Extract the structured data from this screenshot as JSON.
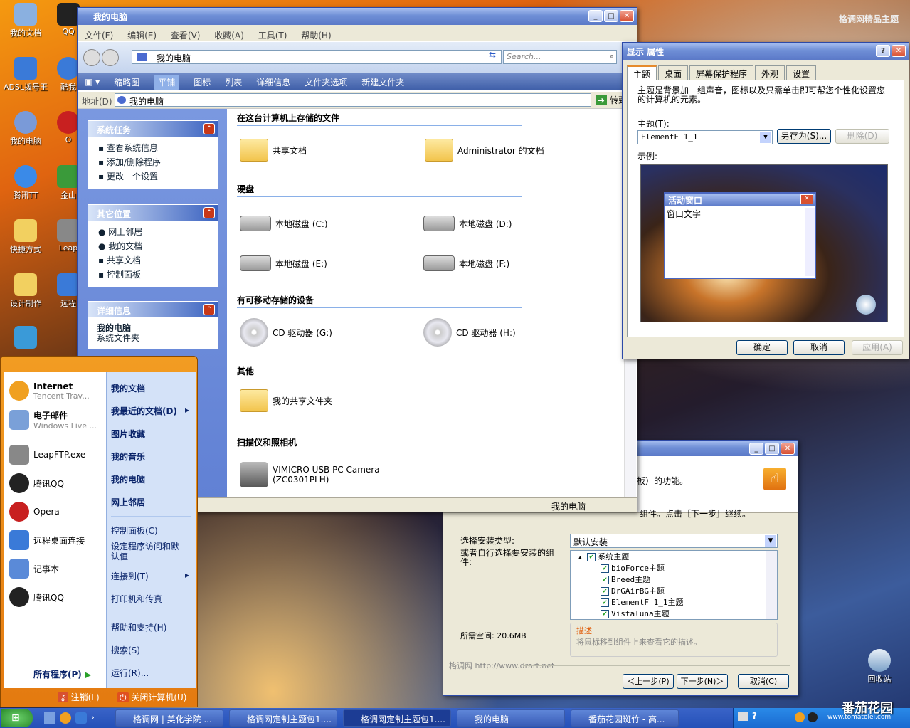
{
  "desktop": {
    "watermark": "格调网精品主题",
    "icons": [
      {
        "label": "我的文档",
        "color": "#8ab0e0"
      },
      {
        "label": "ADSL拨号王",
        "color": "#3a7ad8"
      },
      {
        "label": "我的电脑",
        "color": "#7a9ad8"
      },
      {
        "label": "腾讯TT",
        "color": "#3a8ae8"
      },
      {
        "label": "快捷方式",
        "color": "#f2d060"
      },
      {
        "label": "设计制作",
        "color": "#f2d060"
      },
      {
        "label": "QQ",
        "color": "#222"
      },
      {
        "label": "酷我",
        "color": "#3a7ad8"
      },
      {
        "label": "O",
        "color": "#c82020"
      },
      {
        "label": "金山",
        "color": "#3a9a3a"
      },
      {
        "label": "Leap",
        "color": "#888"
      },
      {
        "label": "远程",
        "color": "#3a7ad8"
      }
    ],
    "recycle_bin": "回收站",
    "brand": "番茄花园",
    "brand_url": "www.tomatolei.com"
  },
  "explorer": {
    "title": "我的电脑",
    "menu": [
      "文件(F)",
      "编辑(E)",
      "查看(V)",
      "收藏(A)",
      "工具(T)",
      "帮助(H)"
    ],
    "breadcrumb": "我的电脑",
    "search_placeholder": "Search...",
    "toolbar": [
      "缩略图",
      "平铺",
      "图标",
      "列表",
      "详细信息",
      "文件夹选项",
      "新建文件夹"
    ],
    "address_label": "地址(D)",
    "address_value": "我的电脑",
    "go_label": "转到",
    "panels": {
      "system_tasks": {
        "title": "系统任务",
        "items": [
          "查看系统信息",
          "添加/删除程序",
          "更改一个设置"
        ]
      },
      "other_places": {
        "title": "其它位置",
        "items": [
          "网上邻居",
          "我的文档",
          "共享文档",
          "控制面板"
        ]
      },
      "details": {
        "title": "详细信息",
        "name": "我的电脑",
        "type": "系统文件夹"
      }
    },
    "sections": {
      "stored": "在这台计算机上存储的文件",
      "hdd": "硬盘",
      "removable": "有可移动存储的设备",
      "other": "其他",
      "scanner": "扫描仪和照相机"
    },
    "items": {
      "shared_docs": "共享文档",
      "admin_docs": "Administrator 的文档",
      "disk_c": "本地磁盘 (C:)",
      "disk_d": "本地磁盘 (D:)",
      "disk_e": "本地磁盘 (E:)",
      "disk_f": "本地磁盘 (F:)",
      "cd_g": "CD 驱动器 (G:)",
      "cd_h": "CD 驱动器 (H:)",
      "my_shared": "我的共享文件夹",
      "camera_line1": "VIMICRO USB PC Camera",
      "camera_line2": "(ZC0301PLH)"
    },
    "status": "我的电脑"
  },
  "display_props": {
    "title": "显示 属性",
    "tabs": [
      "主题",
      "桌面",
      "屏幕保护程序",
      "外观",
      "设置"
    ],
    "description": "主题是背景加一组声音，图标以及只需单击即可帮您个性化设置您的计算机的元素。",
    "theme_label": "主题(T):",
    "theme_value": "ElementF 1_1",
    "save_as": "另存为(S)...",
    "delete": "删除(D)",
    "sample_label": "示例:",
    "sample_window_title": "活动窗口",
    "sample_window_text": "窗口文字",
    "ok": "确定",
    "cancel": "取消",
    "apply": "应用(A)"
  },
  "installer": {
    "header_text": "板）的功能。",
    "instruction": "组件。点击［下一步］继续。",
    "type_label": "选择安装类型:",
    "type_value": "默认安装",
    "custom_label": "或者自行选择要安装的组件:",
    "tree_root": "系统主题",
    "tree_items": [
      "bioForce主题",
      "Breed主题",
      "DrGAirBG主题",
      "ElementF 1_1主题",
      "Vistaluna主题"
    ],
    "desc_title": "描述",
    "desc_text": "将鼠标移到组件上来查看它的描述。",
    "space": "所需空间: 20.6MB",
    "footer": "格调网 http://www.drart.net",
    "back": "＜上一步(P)",
    "next": "下一步(N)＞",
    "cancel": "取消(C)"
  },
  "start_menu": {
    "pinned": [
      {
        "name": "Internet",
        "sub": "Tencent Trav...",
        "color": "#f0a020"
      },
      {
        "name": "电子邮件",
        "sub": "Windows Live ...",
        "color": "#7aa0d8"
      }
    ],
    "recent": [
      {
        "name": "LeapFTP.exe",
        "color": "#888"
      },
      {
        "name": "腾讯QQ",
        "color": "#222"
      },
      {
        "name": "Opera",
        "color": "#c82020"
      },
      {
        "name": "远程桌面连接",
        "color": "#3a7ad8"
      },
      {
        "name": "记事本",
        "color": "#5a8ad8"
      },
      {
        "name": "腾讯QQ",
        "color": "#222"
      }
    ],
    "all_programs": "所有程序(P)",
    "right": [
      "我的文档",
      "我最近的文档(D)",
      "图片收藏",
      "我的音乐",
      "我的电脑",
      "网上邻居",
      "控制面板(C)",
      "设定程序访问和默认值",
      "连接到(T)",
      "打印机和传真",
      "帮助和支持(H)",
      "搜索(S)",
      "运行(R)..."
    ],
    "logoff": "注销(L)",
    "shutdown": "关闭计算机(U)"
  },
  "taskbar": {
    "buttons": [
      "格调网 | 美化学院 ...",
      "格调网定制主题包1....",
      "格调网定制主题包1....",
      "我的电脑",
      "番茄花园斑竹 - 高..."
    ]
  },
  "colors": {
    "accent": "#3a62c0",
    "title_bar": "#5b79c8",
    "link": "#0a246a"
  }
}
